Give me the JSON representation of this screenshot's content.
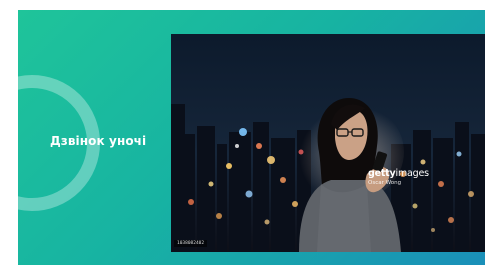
{
  "slide": {
    "title": "Дзвінок уночі",
    "photo": {
      "watermark_brand": "getty",
      "watermark_brand_suffix": "images",
      "watermark_credit": "Oscar Wong",
      "image_id": "1038082402"
    }
  },
  "colors": {
    "gradient_start": "#1fc49a",
    "gradient_end": "#1a8fb9",
    "ring": "rgba(255,255,255,0.32)",
    "title_text": "#ffffff"
  },
  "icons": [
    "ring-decoration",
    "getty-watermark"
  ]
}
